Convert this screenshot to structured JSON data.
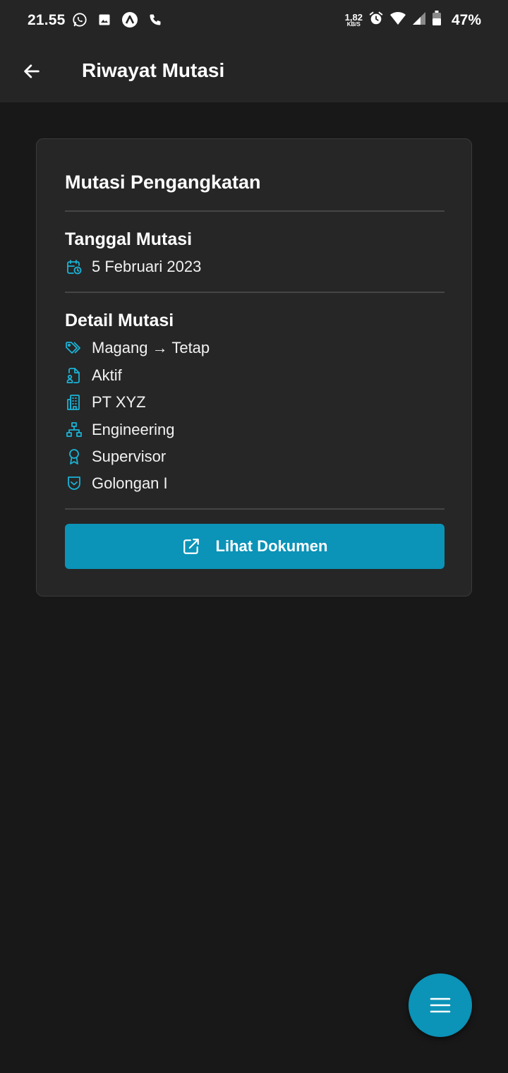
{
  "status_bar": {
    "time": "21.55",
    "net_speed_value": "1,82",
    "net_speed_unit": "KB/S",
    "battery": "47%"
  },
  "app_bar": {
    "title": "Riwayat Mutasi"
  },
  "card": {
    "title": "Mutasi Pengangkatan",
    "date_section": {
      "title": "Tanggal Mutasi",
      "date": "5 Februari 2023"
    },
    "detail_section": {
      "title": "Detail Mutasi",
      "items": [
        {
          "icon": "tags-icon",
          "text": "Magang → Tetap"
        },
        {
          "icon": "file-user-icon",
          "text": "Aktif"
        },
        {
          "icon": "building-icon",
          "text": "PT XYZ"
        },
        {
          "icon": "org-chart-icon",
          "text": "Engineering"
        },
        {
          "icon": "award-icon",
          "text": "Supervisor"
        },
        {
          "icon": "shield-chevron-icon",
          "text": "Golongan I"
        }
      ]
    },
    "button_label": "Lihat Dokumen"
  },
  "colors": {
    "accent": "#0b93b8",
    "icon": "#1ab3d6",
    "background": "#181818",
    "surface": "#262626"
  }
}
